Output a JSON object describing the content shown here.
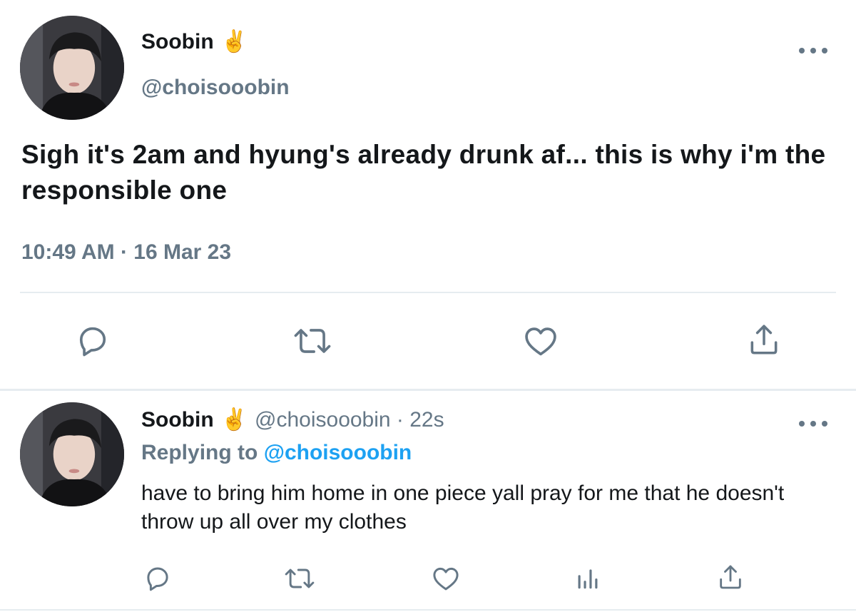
{
  "colors": {
    "text": "#14171a",
    "muted": "#657786",
    "link": "#1da1f2",
    "divider": "#e6ecf0"
  },
  "main_tweet": {
    "display_name": "Soobin",
    "name_emoji": "✌️",
    "handle": "@choisooobin",
    "text": "Sigh it's 2am and hyung's already drunk af... this is why i'm the responsible one",
    "timestamp": "10:49 AM · 16 Mar 23",
    "icons": [
      "reply-icon",
      "retweet-icon",
      "like-icon",
      "share-icon",
      "more-icon"
    ]
  },
  "reply_tweet": {
    "display_name": "Soobin",
    "name_emoji": "✌️",
    "handle_time": "@choisooobin · 22s",
    "replying_to_label": "Replying to",
    "replying_to_handle": "@choisooobin",
    "text": "have to bring him home in one piece yall pray for me that he doesn't throw up all over my clothes",
    "icons": [
      "reply-icon",
      "retweet-icon",
      "like-icon",
      "analytics-icon",
      "share-icon",
      "more-icon"
    ]
  }
}
